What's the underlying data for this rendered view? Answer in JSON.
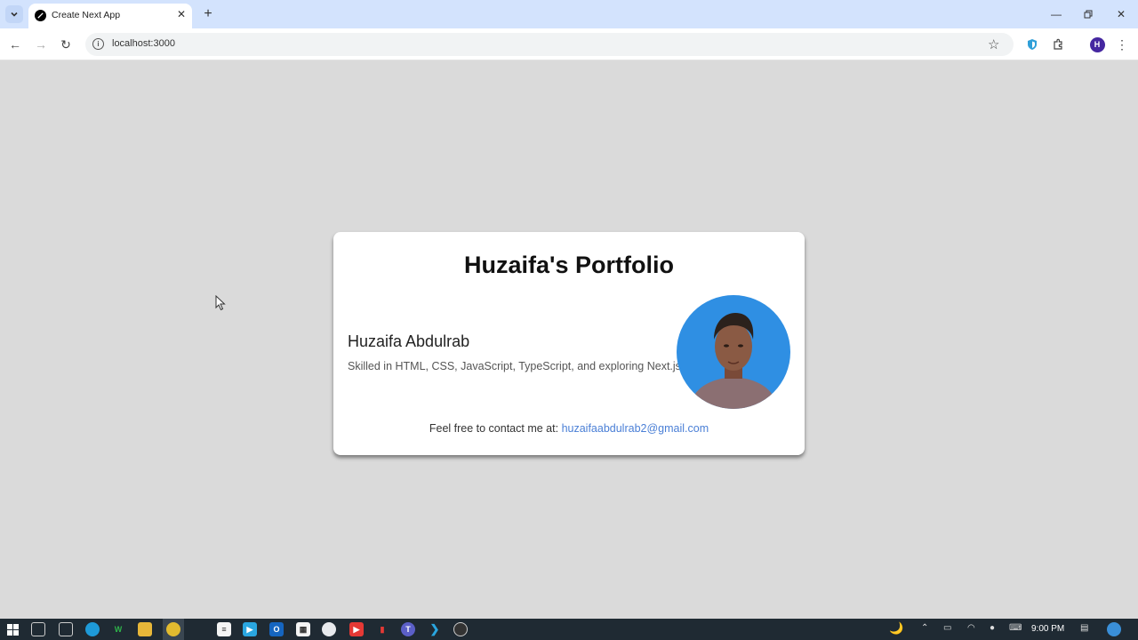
{
  "browser": {
    "tab_title": "Create Next App",
    "url": "localhost:3000",
    "profile_initial": "H"
  },
  "page": {
    "title": "Huzaifa's Portfolio",
    "name": "Huzaifa Abdulrab",
    "skills": "Skilled in HTML, CSS, JavaScript, TypeScript, and exploring Next.js.",
    "contact_prefix": "Feel free to contact me at:",
    "contact_email": "huzaifaabdulrab2@gmail.com"
  },
  "taskbar": {
    "time": "9:00 PM"
  },
  "colors": {
    "tabbar": "#d3e3fd",
    "page_bg": "#dadada",
    "link": "#4a7fd6",
    "photo_bg": "#2f8fe3"
  }
}
